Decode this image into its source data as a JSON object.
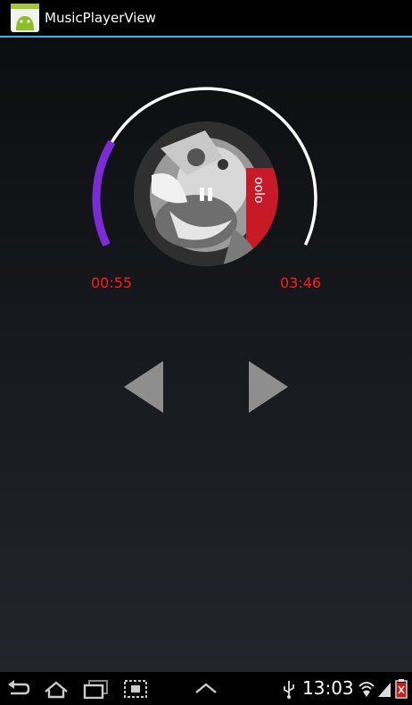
{
  "app": {
    "title": "MusicPlayerView",
    "icon": "android-app-icon"
  },
  "player": {
    "elapsed": "00:55",
    "total": "03:46",
    "progress_fraction": 0.243,
    "state": "playing",
    "center_button_icon": "pause-icon",
    "album_art": "album-cover",
    "colors": {
      "progress": "#7a2bd6",
      "track": "#ffffff",
      "time_text": "#ff1b1b",
      "controls": "#8e8e8e"
    }
  },
  "controls": {
    "prev_icon": "previous-triangle-icon",
    "next_icon": "next-triangle-icon"
  },
  "navbar": {
    "back_icon": "back-icon",
    "home_icon": "home-icon",
    "recents_icon": "recent-apps-icon",
    "screenshot_icon": "screenshot-icon",
    "menu_icon": "chevron-up-icon"
  },
  "statusbar": {
    "time": "13:03",
    "usb_icon": "usb-icon",
    "wifi_icon": "wifi-icon",
    "signal_icon": "signal-icon",
    "battery_icon": "battery-icon"
  }
}
